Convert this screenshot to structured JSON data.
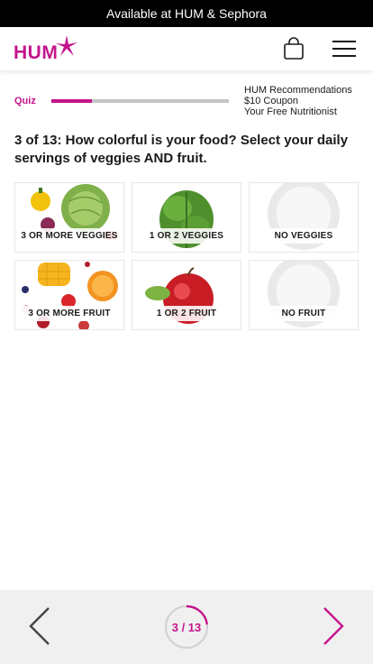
{
  "promo": {
    "text": "Available at HUM & Sephora"
  },
  "header": {
    "logo_text": "HUM",
    "bag_icon": "shopping-bag-icon",
    "menu_icon": "hamburger-menu-icon"
  },
  "progress": {
    "label": "Quiz",
    "current": 3,
    "total": 13
  },
  "perks": [
    "HUM Recommendations",
    "$10 Coupon",
    "Your Free Nutritionist"
  ],
  "question": {
    "text": "3 of 13: How colorful is your food? Select your daily servings of veggies AND fruit."
  },
  "options": [
    {
      "label": "3 OR MORE VEGGIES"
    },
    {
      "label": "1 OR 2 VEGGIES"
    },
    {
      "label": "NO VEGGIES"
    },
    {
      "label": "3 OR MORE FRUIT"
    },
    {
      "label": "1 OR 2 FRUIT"
    },
    {
      "label": "NO FRUIT"
    }
  ],
  "footer": {
    "counter": "3 / 13",
    "prev_icon": "chevron-left-icon",
    "next_icon": "chevron-right-icon"
  },
  "colors": {
    "brand": "#c4148c",
    "promo_bg": "#000000",
    "footer_bg": "#f0f0f0",
    "track": "#c4c4c4"
  }
}
